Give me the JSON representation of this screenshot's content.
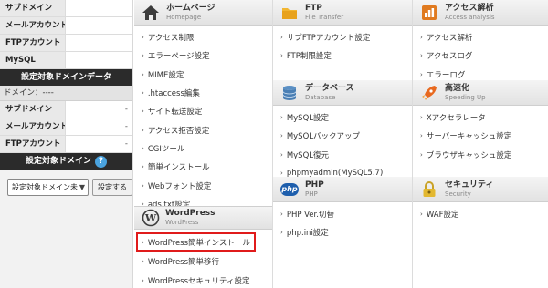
{
  "sidebar": {
    "top_rows": [
      {
        "label": "サブドメイン",
        "value": ""
      },
      {
        "label": "メールアカウント",
        "value": ""
      },
      {
        "label": "FTPアカウント",
        "value": ""
      },
      {
        "label": "MySQL",
        "value": ""
      }
    ],
    "target_domain_data_title": "設定対象ドメインデータ",
    "domain_label": "ドメイン：----",
    "domain_rows": [
      {
        "label": "サブドメイン",
        "value": "-"
      },
      {
        "label": "メールアカウント",
        "value": "-"
      },
      {
        "label": "FTPアカウント",
        "value": "-"
      }
    ],
    "target_domain_title": "設定対象ドメイン",
    "help_glyph": "?",
    "select_value": "設定対象ドメイン未",
    "set_button": "設定する"
  },
  "homepage": {
    "title": "ホームページ",
    "subtitle": "Homepage",
    "items": [
      "アクセス制限",
      "エラーページ設定",
      "MIME設定",
      ".htaccess編集",
      "サイト転送設定",
      "アクセス拒否設定",
      "CGIツール",
      "簡単インストール",
      "Webフォント設定",
      "ads.txt設定"
    ]
  },
  "wordpress": {
    "title": "WordPress",
    "subtitle": "WordPress",
    "items": [
      "WordPress簡単インストール",
      "WordPress簡単移行",
      "WordPressセキュリティ設定"
    ],
    "highlighted_index": 0
  },
  "ftp": {
    "title": "FTP",
    "subtitle": "File Transfer",
    "items": [
      "サブFTPアカウント設定",
      "FTP制限設定"
    ]
  },
  "database": {
    "title": "データベース",
    "subtitle": "Database",
    "items": [
      "MySQL設定",
      "MySQLバックアップ",
      "MySQL復元",
      "phpmyadmin(MySQL5.7)"
    ]
  },
  "php": {
    "title": "PHP",
    "subtitle": "PHP",
    "badge": "php",
    "items": [
      "PHP Ver.切替",
      "php.ini設定"
    ]
  },
  "access_analysis": {
    "title": "アクセス解析",
    "subtitle": "Access analysis",
    "items": [
      "アクセス解析",
      "アクセスログ",
      "エラーログ"
    ]
  },
  "speed": {
    "title": "高速化",
    "subtitle": "Speeding Up",
    "items": [
      "Xアクセラレータ",
      "サーバーキャッシュ設定",
      "ブラウザキャッシュ設定"
    ]
  },
  "security": {
    "title": "セキュリティ",
    "subtitle": "Security",
    "items": [
      "WAF設定"
    ]
  },
  "colors": {
    "highlight_border": "#e01b1b",
    "sidebar_header": "#2b2b2b",
    "help_icon": "#4aa3df"
  }
}
